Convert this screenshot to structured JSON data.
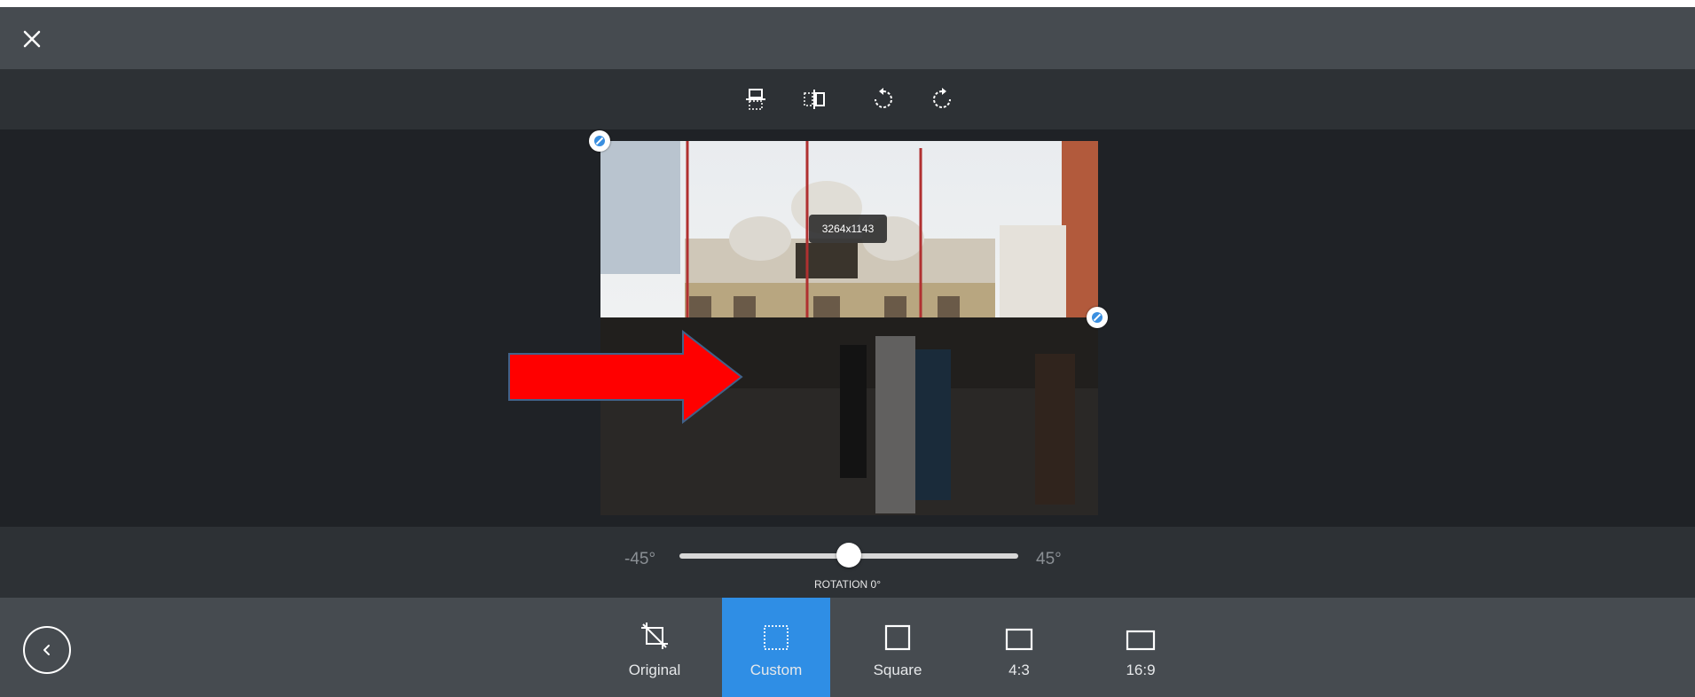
{
  "header": {
    "close_icon": "close-icon"
  },
  "toolbar": {
    "tools": [
      {
        "name": "flip-vertical",
        "icon": "flip-vertical-icon"
      },
      {
        "name": "flip-horizontal",
        "icon": "flip-horizontal-icon"
      },
      {
        "name": "rotate-left",
        "icon": "rotate-left-icon"
      },
      {
        "name": "rotate-right",
        "icon": "rotate-right-icon"
      }
    ]
  },
  "crop": {
    "size_label": "3264x1143",
    "annotation_color": "#ff0000"
  },
  "rotation": {
    "min_label": "-45°",
    "max_label": "45°",
    "label": "ROTATION 0°",
    "value_fraction": 0.5
  },
  "ratios": [
    {
      "label": "Original",
      "icon": "crop-off-icon",
      "active": false
    },
    {
      "label": "Custom",
      "icon": "custom-crop-icon",
      "active": true
    },
    {
      "label": "Square",
      "icon": "square-icon",
      "active": false
    },
    {
      "label": "4:3",
      "icon": "ratio-4-3-icon",
      "active": false
    },
    {
      "label": "16:9",
      "icon": "ratio-16-9-icon",
      "active": false
    }
  ],
  "colors": {
    "accent": "#2f8ee5",
    "panel": "#464b50",
    "toolbar": "#2d3135",
    "canvas": "#1f2226"
  }
}
